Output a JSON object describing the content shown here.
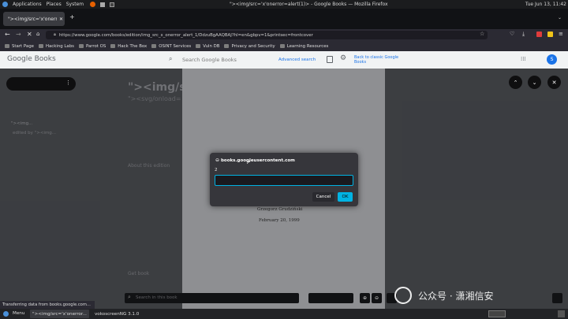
{
  "os": {
    "menus": [
      "Applications",
      "Places",
      "System"
    ],
    "window_title": "\"><img/src='x'onerror=alert(1)> - Google Books — Mozilla Firefox",
    "clock": "Tue Jun 13, 11:42"
  },
  "browser": {
    "tab_label": "\"><img/src='x'onerror=...",
    "new_tab": "+",
    "url": "https://www.google.com/books/edition/img_src_x_onerror_alert_1/DdzuBgAAQBAJ?hl=en&gbpv=1&printsec=frontcover",
    "bookmarks": [
      "Start Page",
      "Hacking Labs",
      "Parrot OS",
      "Hack The Box",
      "OSINT Services",
      "Vuln DB",
      "Privacy and Security",
      "Learning Resources"
    ],
    "status": "Transferring data from books.google.com..."
  },
  "google_books": {
    "logo": "Google Books",
    "search_placeholder": "Search Google Books",
    "advanced_search": "Advanced search",
    "back_to_classic": "Back to classic Google Books",
    "avatar_letter": "S",
    "book_title": "\"><img/sr",
    "book_subtitle": "\"><svg/onload=",
    "edited_by": "edited by \"><img...",
    "about_heading": "About this edition",
    "get_book": "Get book",
    "author": "Grzegorz Grudziński",
    "date": "February 20, 1999",
    "viewer_search_placeholder": "Search in this book"
  },
  "dialog": {
    "origin": "books.googleusercontent.com",
    "message": "2",
    "input_value": "",
    "cancel_label": "Cancel",
    "ok_label": "OK"
  },
  "taskbar": {
    "menu_label": "Menu",
    "tasks": [
      "\"><img/src='x'onerror...",
      "vokoscreenNG 3.1.0"
    ]
  },
  "watermark": "公众号 · 潇湘信安"
}
